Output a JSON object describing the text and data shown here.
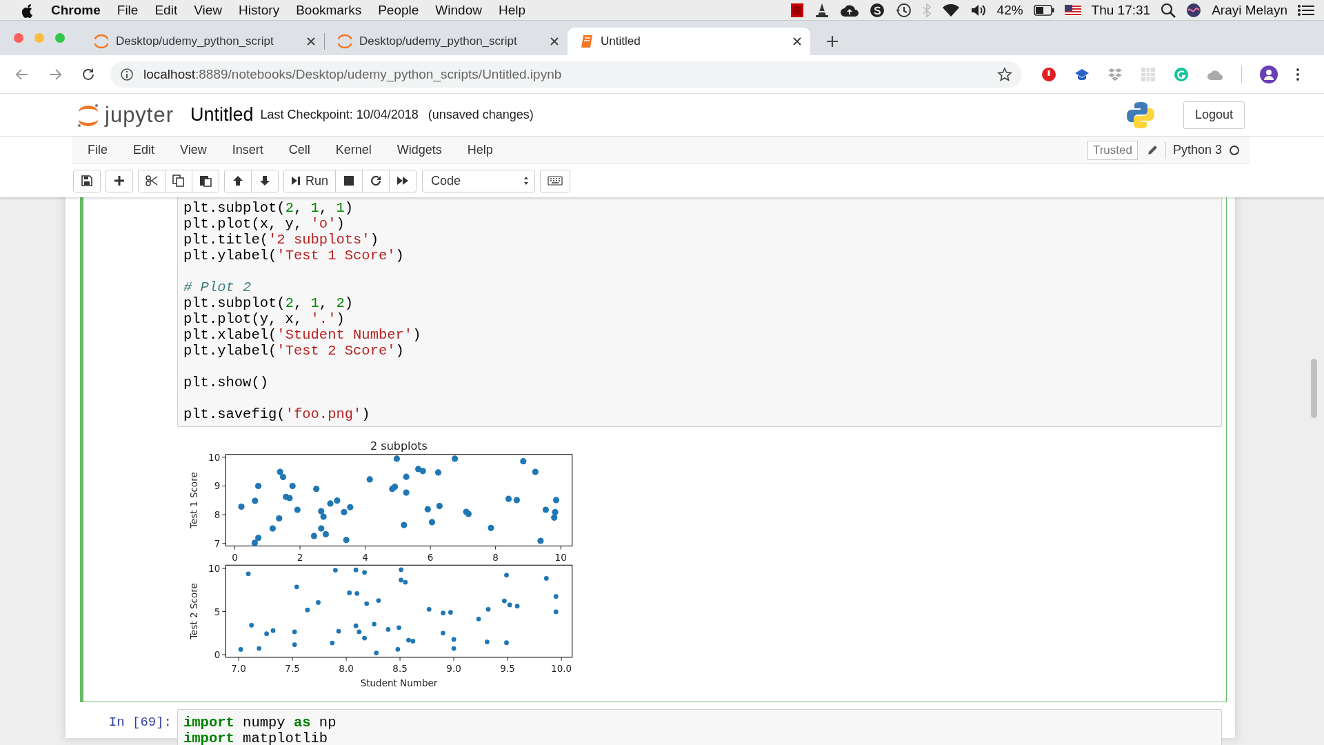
{
  "menubar": {
    "app": "Chrome",
    "items": [
      "File",
      "Edit",
      "View",
      "History",
      "Bookmarks",
      "People",
      "Window",
      "Help"
    ],
    "battery_percent": "42%",
    "clock": "Thu 17:31",
    "user": "Arayi Melayn"
  },
  "tabs": [
    {
      "title": "Desktop/udemy_python_script",
      "kind": "jupyter",
      "selected": false
    },
    {
      "title": "Desktop/udemy_python_script",
      "kind": "jupyter",
      "selected": false
    },
    {
      "title": "Untitled",
      "kind": "notebook",
      "selected": true
    }
  ],
  "address": {
    "host": "localhost",
    "path": ":8889/notebooks/Desktop/udemy_python_scripts/Untitled.ipynb"
  },
  "notebook_header": {
    "logo_text": "jupyter",
    "name": "Untitled",
    "checkpoint": "Last Checkpoint: 10/04/2018",
    "status": "(unsaved changes)",
    "logout": "Logout"
  },
  "notebook_menu": {
    "items": [
      "File",
      "Edit",
      "View",
      "Insert",
      "Cell",
      "Kernel",
      "Widgets",
      "Help"
    ],
    "trusted": "Trusted",
    "kernel": "Python 3"
  },
  "toolbar": {
    "run": "Run",
    "cell_type": "Code"
  },
  "cells": [
    {
      "selected": true,
      "code": [
        [
          [
            {
              "kind": "plain",
              "text": "plt.subplot("
            },
            {
              "kind": "num",
              "text": "2"
            },
            {
              "kind": "plain",
              "text": ", "
            },
            {
              "kind": "num",
              "text": "1"
            },
            {
              "kind": "plain",
              "text": ", "
            },
            {
              "kind": "num",
              "text": "1"
            },
            {
              "kind": "plain",
              "text": ")"
            }
          ],
          [
            {
              "kind": "plain",
              "text": "plt.plot(x, y, "
            },
            {
              "kind": "str",
              "text": "'o'"
            },
            {
              "kind": "plain",
              "text": ")"
            }
          ],
          [
            {
              "kind": "plain",
              "text": "plt.title("
            },
            {
              "kind": "str",
              "text": "'2 subplots'"
            },
            {
              "kind": "plain",
              "text": ")"
            }
          ],
          [
            {
              "kind": "plain",
              "text": "plt.ylabel("
            },
            {
              "kind": "str",
              "text": "'Test 1 Score'"
            },
            {
              "kind": "plain",
              "text": ")"
            }
          ]
        ],
        [
          [
            {
              "kind": "comment",
              "text": "# Plot 2"
            }
          ],
          [
            {
              "kind": "plain",
              "text": "plt.subplot("
            },
            {
              "kind": "num",
              "text": "2"
            },
            {
              "kind": "plain",
              "text": ", "
            },
            {
              "kind": "num",
              "text": "1"
            },
            {
              "kind": "plain",
              "text": ", "
            },
            {
              "kind": "num",
              "text": "2"
            },
            {
              "kind": "plain",
              "text": ")"
            }
          ],
          [
            {
              "kind": "plain",
              "text": "plt.plot(y, x, "
            },
            {
              "kind": "str",
              "text": "'.'"
            },
            {
              "kind": "plain",
              "text": ")"
            }
          ],
          [
            {
              "kind": "plain",
              "text": "plt.xlabel("
            },
            {
              "kind": "str",
              "text": "'Student Number'"
            },
            {
              "kind": "plain",
              "text": ")"
            }
          ],
          [
            {
              "kind": "plain",
              "text": "plt.ylabel("
            },
            {
              "kind": "str",
              "text": "'Test 2 Score'"
            },
            {
              "kind": "plain",
              "text": ")"
            }
          ]
        ],
        [
          [
            {
              "kind": "plain",
              "text": "plt.show()"
            }
          ]
        ],
        [
          [
            {
              "kind": "plain",
              "text": "plt.savefig("
            },
            {
              "kind": "str",
              "text": "'foo.png'"
            },
            {
              "kind": "plain",
              "text": ")"
            }
          ]
        ]
      ],
      "output": {
        "charts": [
          {
            "chart_data": {
              "type": "scatter",
              "title": "2 subplots",
              "ylabel": "Test 1 Score",
              "xlim": [
                -0.28,
                10.35
              ],
              "ylim": [
                6.91,
                10.1
              ],
              "xticks": [
                0,
                2,
                4,
                6,
                8,
                10
              ],
              "yticks": [
                7,
                8,
                9,
                10
              ],
              "x": [
                0.2,
                0.62,
                0.61,
                0.72,
                0.72,
                1.16,
                1.36,
                1.39,
                1.48,
                1.57,
                1.68,
                1.77,
                1.92,
                2.43,
                2.5,
                2.65,
                2.65,
                2.72,
                2.79,
                2.93,
                3.14,
                3.35,
                3.42,
                3.54,
                4.14,
                4.83,
                4.91,
                4.97,
                5.19,
                5.26,
                5.26,
                5.63,
                5.77,
                5.92,
                6.05,
                6.24,
                6.28,
                6.75,
                7.1,
                7.17,
                7.86,
                8.4,
                8.65,
                8.85,
                9.22,
                9.38,
                9.54,
                9.8,
                9.83,
                9.86
              ],
              "series": [
                {
                  "color": "#1f77b4",
                  "marker": "circle",
                  "values": [
                    8.28,
                    8.48,
                    7.02,
                    7.19,
                    9.0,
                    7.52,
                    7.87,
                    9.49,
                    9.31,
                    8.62,
                    8.58,
                    9.0,
                    8.17,
                    7.26,
                    8.9,
                    8.12,
                    7.52,
                    7.93,
                    7.32,
                    8.39,
                    8.49,
                    8.09,
                    7.12,
                    8.26,
                    9.23,
                    8.9,
                    8.97,
                    9.95,
                    7.64,
                    9.32,
                    8.77,
                    9.59,
                    9.52,
                    8.19,
                    7.74,
                    9.47,
                    8.3,
                    9.95,
                    8.1,
                    8.03,
                    7.54,
                    8.55,
                    8.51,
                    9.86,
                    9.49,
                    7.09,
                    8.17,
                    7.9,
                    8.09,
                    8.51
                  ]
                }
              ]
            }
          },
          {
            "chart_data": {
              "type": "scatter",
              "xlabel": "Student Number",
              "ylabel": "Test 2 Score",
              "xlim": [
                6.88,
                10.1
              ],
              "ylim": [
                -0.3,
                10.38
              ],
              "xticks": [
                {
                  "value": 7,
                  "label": "7.0"
                },
                {
                  "value": 7.5,
                  "label": "7.5"
                },
                {
                  "value": 8,
                  "label": "8.0"
                },
                {
                  "value": 8.5,
                  "label": "8.5"
                },
                {
                  "value": 9,
                  "label": "9.0"
                },
                {
                  "value": 9.5,
                  "label": "9.5"
                },
                {
                  "value": 10,
                  "label": "10.0"
                }
              ],
              "yticks": [
                0,
                5,
                10
              ],
              "x": [
                8.28,
                8.48,
                7.02,
                7.19,
                9.0,
                7.52,
                7.87,
                9.49,
                9.31,
                8.62,
                8.58,
                9.0,
                8.17,
                7.26,
                8.9,
                8.12,
                7.52,
                7.93,
                7.32,
                8.39,
                8.49,
                8.09,
                7.12,
                8.26,
                9.23,
                8.9,
                8.97,
                9.95,
                7.64,
                9.32,
                8.77,
                9.59,
                9.52,
                8.19,
                7.74,
                9.47,
                8.3,
                9.95,
                8.1,
                8.03,
                7.54,
                8.55,
                8.51,
                9.86,
                9.49,
                7.09,
                8.17,
                7.9,
                8.09,
                8.51
              ],
              "series": [
                {
                  "color": "#1f77b4",
                  "marker": "circle",
                  "values": [
                    0.2,
                    0.62,
                    0.61,
                    0.72,
                    0.72,
                    1.16,
                    1.36,
                    1.39,
                    1.48,
                    1.57,
                    1.68,
                    1.77,
                    1.92,
                    2.43,
                    2.5,
                    2.65,
                    2.65,
                    2.72,
                    2.79,
                    2.93,
                    3.14,
                    3.35,
                    3.42,
                    3.54,
                    4.14,
                    4.83,
                    4.91,
                    4.97,
                    5.19,
                    5.26,
                    5.26,
                    5.63,
                    5.77,
                    5.92,
                    6.05,
                    6.24,
                    6.28,
                    6.75,
                    7.1,
                    7.17,
                    7.86,
                    8.4,
                    8.65,
                    8.85,
                    9.22,
                    9.38,
                    9.54,
                    9.8,
                    9.83,
                    9.86
                  ]
                }
              ]
            }
          }
        ]
      }
    },
    {
      "selected": false,
      "prompt": "In [69]:",
      "code": [
        [
          [
            {
              "kind": "kw",
              "text": "import"
            },
            {
              "kind": "plain",
              "text": " numpy "
            },
            {
              "kind": "kw",
              "text": "as"
            },
            {
              "kind": "plain",
              "text": " np"
            }
          ],
          [
            {
              "kind": "kw",
              "text": "import"
            },
            {
              "kind": "plain",
              "text": " matplotlib"
            }
          ]
        ]
      ]
    }
  ]
}
